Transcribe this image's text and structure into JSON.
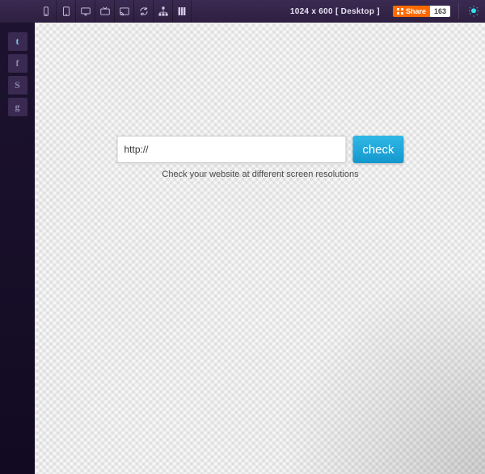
{
  "topbar": {
    "resolution_label": "1024 x 600 [ Desktop ]",
    "share_label": "Share",
    "share_count": "163",
    "devices": [
      {
        "name": "phone-icon"
      },
      {
        "name": "tablet-icon"
      },
      {
        "name": "desktop-icon"
      },
      {
        "name": "tv-icon"
      },
      {
        "name": "cast-icon"
      },
      {
        "name": "refresh-icon"
      },
      {
        "name": "sitemap-icon"
      },
      {
        "name": "columns-icon"
      }
    ],
    "bulb_name": "lightbulb-icon"
  },
  "sidebar": {
    "social": [
      {
        "name": "twitter-icon",
        "glyph": "t"
      },
      {
        "name": "facebook-icon",
        "glyph": "f"
      },
      {
        "name": "skype-icon",
        "glyph": "S"
      },
      {
        "name": "google-plus-icon",
        "glyph": "g"
      }
    ]
  },
  "form": {
    "url_value": "http://",
    "url_placeholder": "http://",
    "check_label": "check",
    "tagline": "Check your website at different screen resolutions"
  },
  "colors": {
    "accent": "#1bb0c9",
    "button": "#1ca4d8",
    "share": "#ff6a00",
    "header": "#33254a",
    "sidebar": "#170d28"
  }
}
